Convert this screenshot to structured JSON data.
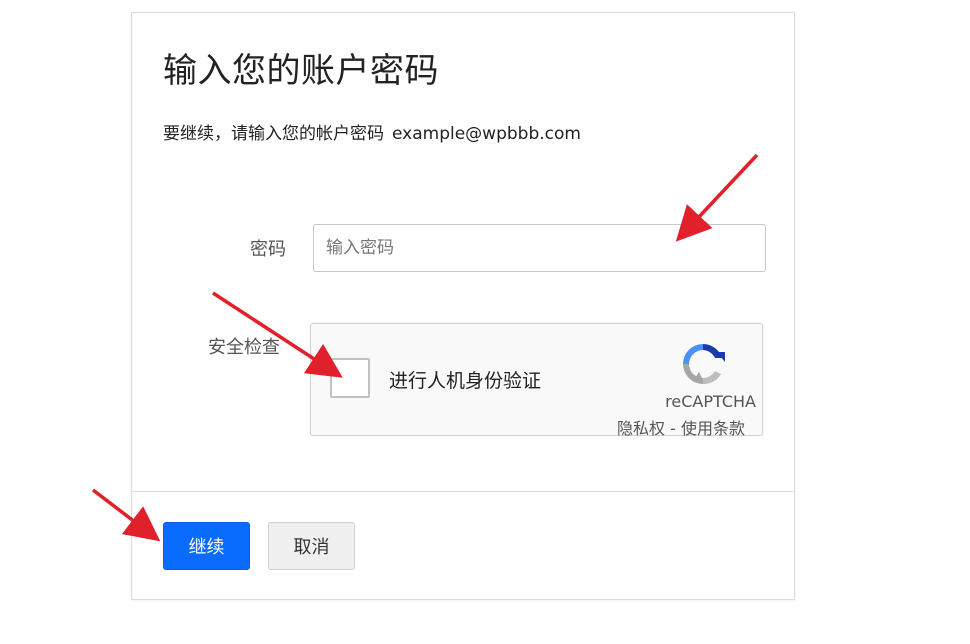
{
  "dialog": {
    "title": "输入您的账户密码",
    "subtitle_prefix": "要继续，请输入您的帐户密码",
    "email": "example@wpbbb.com"
  },
  "password": {
    "label": "密码",
    "placeholder": "输入密码",
    "value": ""
  },
  "security": {
    "label": "安全检查",
    "recaptcha": {
      "checkbox_label": "进行人机身份验证",
      "brand": "reCAPTCHA",
      "privacy_link": "隐私权",
      "separator": " - ",
      "terms_link": "使用条款",
      "checked": false,
      "logo_icon": "recaptcha-logo-icon"
    }
  },
  "actions": {
    "continue_label": "继续",
    "cancel_label": "取消"
  },
  "colors": {
    "primary_button": "#0a6cff",
    "annotation_arrow": "#e0202a"
  }
}
